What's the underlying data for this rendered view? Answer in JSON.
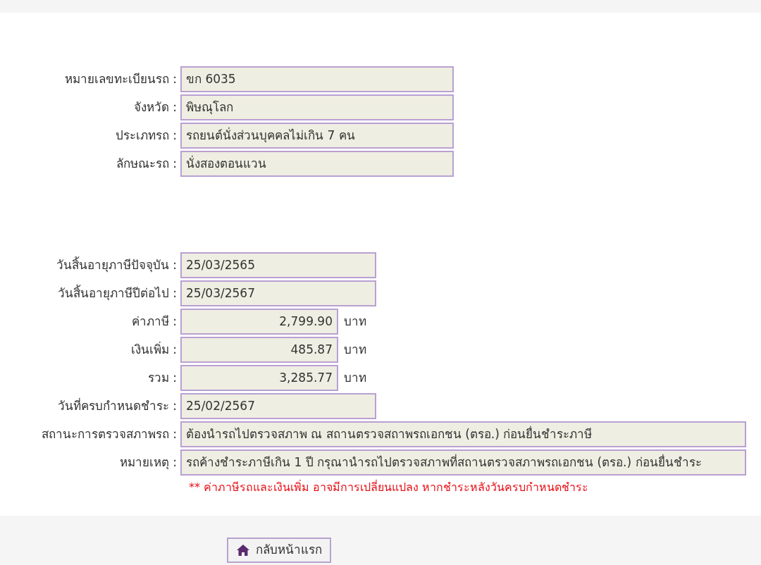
{
  "vehicle_section": [
    {
      "label": "หมายเลขทะเบียนรถ :",
      "value": "ขก 6035",
      "kind": "wide"
    },
    {
      "label": "จังหวัด :",
      "value": "พิษณุโลก",
      "kind": "wide"
    },
    {
      "label": "ประเภทรถ :",
      "value": "รถยนต์นั่งส่วนบุคคลไม่เกิน 7 คน",
      "kind": "wide"
    },
    {
      "label": "ลักษณะรถ :",
      "value": "นั่งสองตอนแวน",
      "kind": "wide"
    }
  ],
  "tax_section": [
    {
      "label": "วันสิ้นอายุภาษีปัจจุบัน :",
      "value": "25/03/2565",
      "kind": "date"
    },
    {
      "label": "วันสิ้นอายุภาษีปีต่อไป :",
      "value": "25/03/2567",
      "kind": "date"
    },
    {
      "label": "ค่าภาษี :",
      "value": "2,799.90",
      "kind": "money",
      "unit": "บาท"
    },
    {
      "label": "เงินเพิ่ม :",
      "value": "485.87",
      "kind": "money",
      "unit": "บาท"
    },
    {
      "label": "รวม :",
      "value": "3,285.77",
      "kind": "money",
      "unit": "บาท"
    },
    {
      "label": "วันที่ครบกำหนดชำระ :",
      "value": "25/02/2567",
      "kind": "date"
    },
    {
      "label": "สถานะการตรวจสภาพรถ :",
      "value": "ต้องนำรถไปตรวจสภาพ ณ สถานตรวจสถาพรถเอกชน (ตรอ.) ก่อนยื่นชำระภาษี",
      "kind": "full"
    },
    {
      "label": "หมายเหตุ :",
      "value": "รถค้างชำระภาษีเกิน 1 ปี กรุณานำรถไปตรวจสภาพที่สถานตรวจสภาพรถเอกชน (ตรอ.) ก่อนยื่นชำระ",
      "kind": "full"
    }
  ],
  "warning_note": "** ค่าภาษีรถและเงินเพิ่ม อาจมีการเปลี่ยนแปลง หากชำระหลังวันครบกำหนดชำระ",
  "home_button": {
    "label": "กลับหน้าแรก"
  }
}
